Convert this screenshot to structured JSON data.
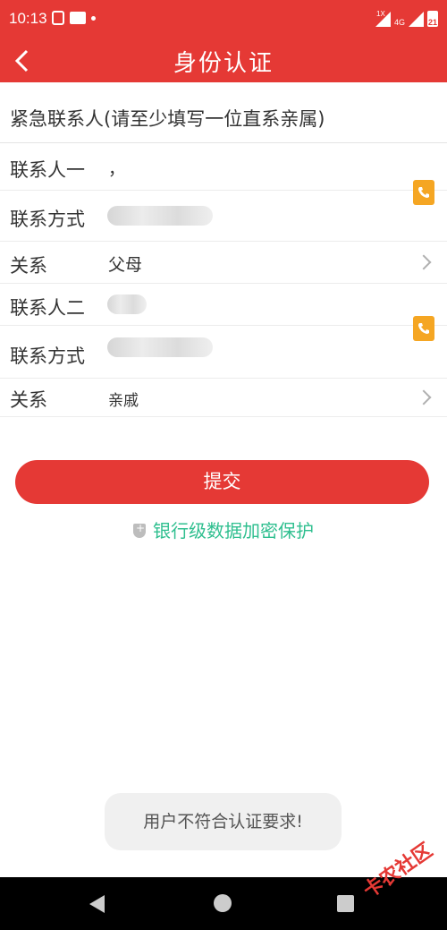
{
  "status_bar": {
    "time": "10:13",
    "signal_labels": [
      "1X",
      "4G"
    ],
    "battery": "21"
  },
  "header": {
    "title": "身份认证"
  },
  "section": {
    "title": "紧急联系人(请至少填写一位直系亲属)"
  },
  "contact1": {
    "name_label": "联系人一",
    "name_value": "，",
    "phone_label": "联系方式",
    "phone_value": "",
    "relation_label": "关系",
    "relation_value": "父母"
  },
  "contact2": {
    "name_label": "联系人二",
    "name_value": "",
    "phone_label": "联系方式",
    "phone_value": "",
    "relation_label": "关系",
    "relation_value": "亲戚"
  },
  "submit": {
    "label": "提交"
  },
  "security": {
    "text": "银行级数据加密保护"
  },
  "toast": {
    "text": "用户不符合认证要求!"
  },
  "watermark": {
    "text": "卡农社区"
  },
  "colors": {
    "brand": "#e53935",
    "accent_secure": "#2fbf8f",
    "phone_icon": "#f5a623"
  }
}
